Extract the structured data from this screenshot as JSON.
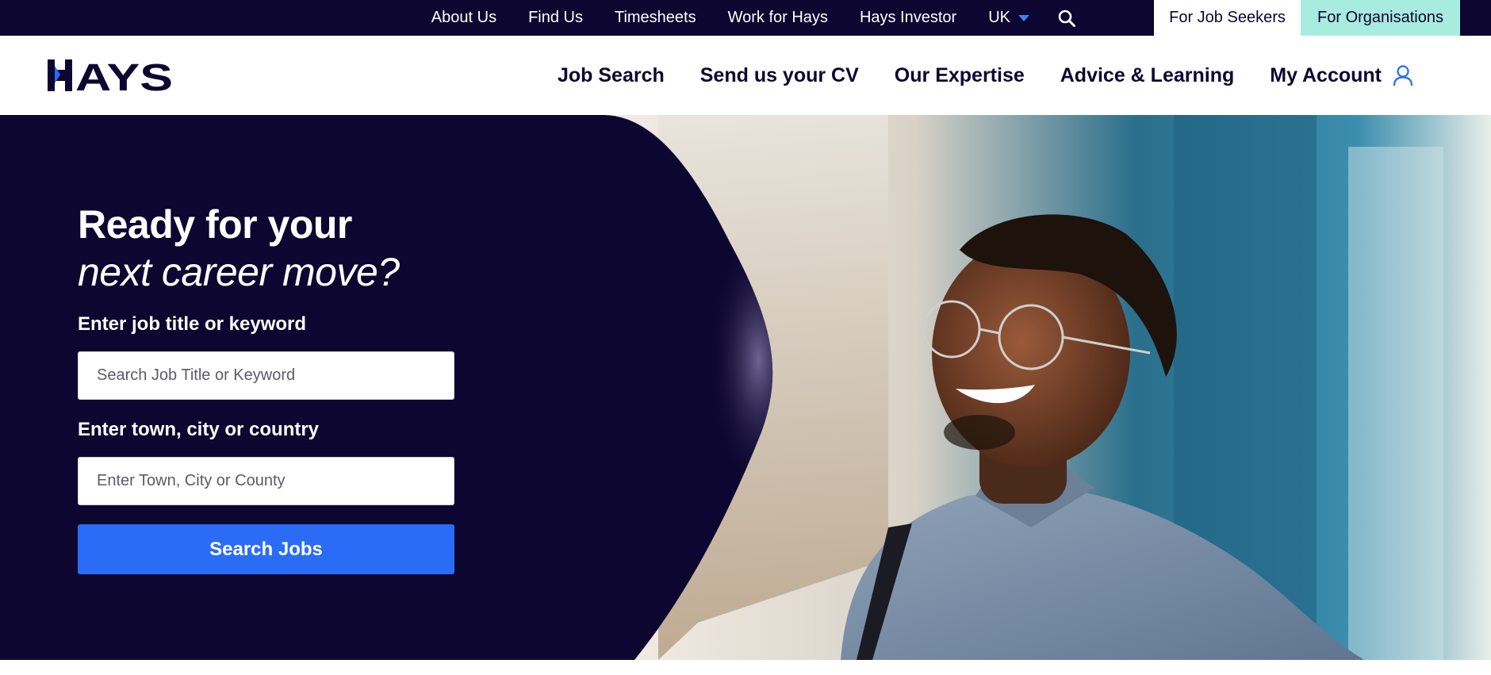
{
  "utility_nav": {
    "links": [
      "About Us",
      "Find Us",
      "Timesheets",
      "Work for Hays",
      "Hays Investor"
    ],
    "country": "UK",
    "search_icon": "search-icon",
    "audience": {
      "job_seekers": "For Job Seekers",
      "organisations": "For Organisations"
    }
  },
  "header": {
    "logo_text": "HAYS",
    "nav": [
      "Job Search",
      "Send us your CV",
      "Our Expertise",
      "Advice & Learning",
      "My Account"
    ],
    "account_icon": "user-icon"
  },
  "hero": {
    "title_line1": "Ready for your",
    "title_line2": "next career move?",
    "keyword_label": "Enter job title or keyword",
    "keyword_placeholder": "Search Job Title or Keyword",
    "location_label": "Enter town, city or country",
    "location_placeholder": "Enter Town, City or County",
    "search_button": "Search Jobs"
  },
  "colors": {
    "navy": "#0d0630",
    "accent_blue": "#2a6cf6",
    "mint": "#a8ecdf",
    "white": "#ffffff"
  }
}
